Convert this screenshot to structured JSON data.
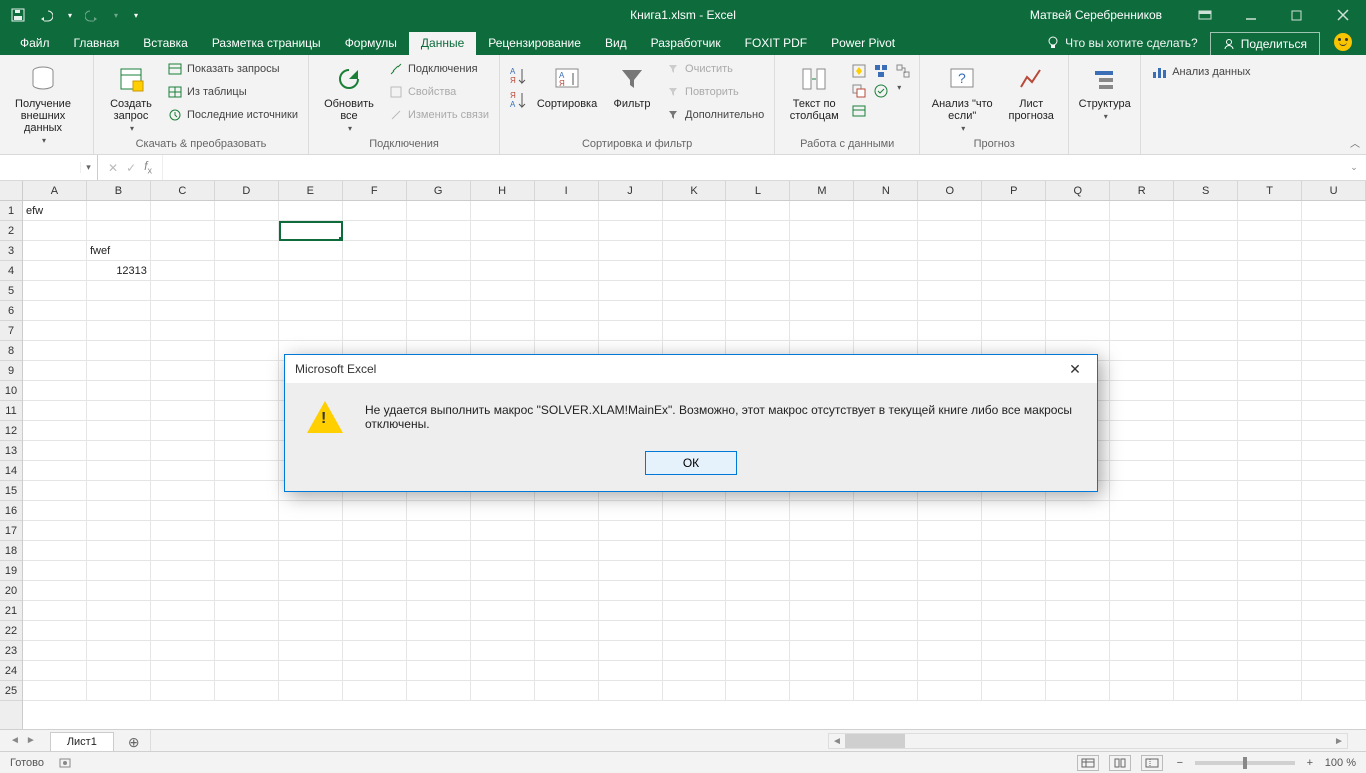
{
  "titlebar": {
    "doc_title": "Книга1.xlsm  -  Excel",
    "user_name": "Матвей Серебренников"
  },
  "tabs": {
    "file": "Файл",
    "items": [
      "Главная",
      "Вставка",
      "Разметка страницы",
      "Формулы",
      "Данные",
      "Рецензирование",
      "Вид",
      "Разработчик",
      "FOXIT PDF",
      "Power Pivot"
    ],
    "active_index": 4,
    "tellme": "Что вы хотите сделать?",
    "share": "Поделиться"
  },
  "ribbon": {
    "g1": {
      "big": "Получение\nвнешних данных",
      "label": ""
    },
    "g2": {
      "big": "Создать\nзапрос",
      "i1": "Показать запросы",
      "i2": "Из таблицы",
      "i3": "Последние источники",
      "label": "Скачать & преобразовать"
    },
    "g3": {
      "big": "Обновить\nвсе",
      "i1": "Подключения",
      "i2": "Свойства",
      "i3": "Изменить связи",
      "label": "Подключения"
    },
    "g4": {
      "b1": "Сортировка",
      "b2": "Фильтр",
      "i1": "Очистить",
      "i2": "Повторить",
      "i3": "Дополнительно",
      "label": "Сортировка и фильтр"
    },
    "g5": {
      "big": "Текст по\nстолбцам",
      "label": "Работа с данными"
    },
    "g6": {
      "b1": "Анализ \"что\nесли\"",
      "b2": "Лист\nпрогноза",
      "label": "Прогноз"
    },
    "g7": {
      "big": "Структура",
      "label": ""
    },
    "g8": {
      "i1": "Анализ данных",
      "label": ""
    }
  },
  "fbar": {
    "name": "",
    "formula": ""
  },
  "grid": {
    "cols": [
      "A",
      "B",
      "C",
      "D",
      "E",
      "F",
      "G",
      "H",
      "I",
      "J",
      "K",
      "L",
      "M",
      "N",
      "O",
      "P",
      "Q",
      "R",
      "S",
      "T",
      "U"
    ],
    "rows": 25,
    "cells": {
      "A1": "efw",
      "B3": "fwef",
      "B4": "12313"
    },
    "numeric": [
      "B4"
    ],
    "selected": "E2"
  },
  "sheets": {
    "active": "Лист1"
  },
  "status": {
    "ready": "Готово",
    "zoom": "100 %"
  },
  "dialog": {
    "title": "Microsoft Excel",
    "message": "Не удается выполнить макрос \"SOLVER.XLAM!MainEx\". Возможно, этот макрос отсутствует в текущей книге либо все макросы отключены.",
    "ok": "ОК"
  }
}
